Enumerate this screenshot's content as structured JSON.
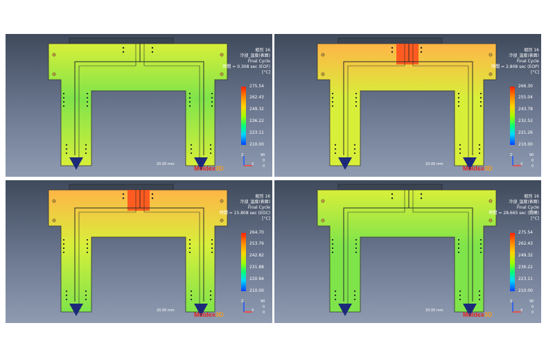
{
  "panels": [
    {
      "id": "p1",
      "title": "組別 16",
      "quantity": "冷卻_溫度(表面)",
      "cycle": "Final Cycle",
      "time": "時間 = 0.308 sec (EOF)",
      "unit": "[°C]",
      "ticks": [
        "275.54",
        "262.43",
        "249.32",
        "236.22",
        "223.11",
        "210.00"
      ],
      "scale": "20.00 mm",
      "axes": {
        "z": "Z",
        "x": "X",
        "n1": "90",
        "n2": "0",
        "n3": "0"
      }
    },
    {
      "id": "p2",
      "title": "組別 16",
      "quantity": "冷卻_溫度(表面)",
      "cycle": "Final Cycle",
      "time": "時間 = 2.808 sec (EOP)",
      "unit": "[°C]",
      "ticks": [
        "266.30",
        "255.04",
        "243.78",
        "232.52",
        "221.26",
        "210.00"
      ],
      "scale": "20.00 mm",
      "axes": {
        "z": "Z",
        "x": "X",
        "n1": "90",
        "n2": "0",
        "n3": "0"
      }
    },
    {
      "id": "p3",
      "title": "組別 16",
      "quantity": "冷卻_溫度(表面)",
      "cycle": "Final Cycle",
      "time": "時間 = 15.808 sec (EOC)",
      "unit": "[°C]",
      "ticks": [
        "264.70",
        "253.76",
        "242.82",
        "231.88",
        "220.94",
        "210.00"
      ],
      "scale": "20.00 mm",
      "axes": {
        "z": "Z",
        "x": "X",
        "n1": "90",
        "n2": "0",
        "n3": "0"
      }
    },
    {
      "id": "p4",
      "title": "組別 16",
      "quantity": "冷卻_溫度(表面)",
      "cycle": "Final Cycle",
      "time": "時間 = 28.665 sec (開模)",
      "unit": "[°C]",
      "ticks": [
        "275.54",
        "262.43",
        "249.32",
        "236.22",
        "223.11",
        "210.00"
      ],
      "scale": "20.00 mm",
      "axes": {
        "z": "Z",
        "x": "X",
        "n1": "90",
        "n2": "0",
        "n3": "0"
      }
    }
  ],
  "logo": {
    "text": "Moldex",
    "suffix": "3D"
  },
  "colors": {
    "hot": "#ff4a1a",
    "warm": "#ffb547",
    "mid": "#d8ef3a",
    "cool": "#7fe44a",
    "cold": "#2fd8c0"
  }
}
